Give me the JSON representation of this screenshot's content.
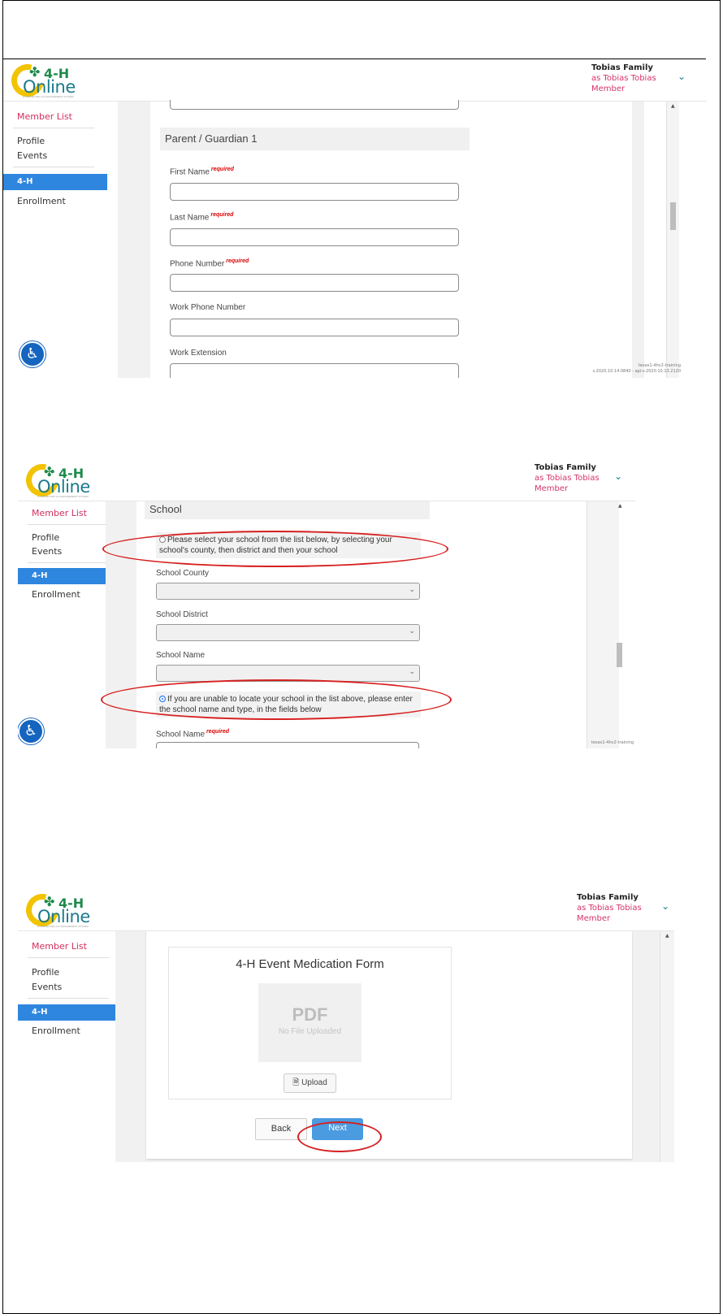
{
  "brand": {
    "logo_4h": "4-H",
    "logo_online": "Online",
    "logo_tagline": "A CONNECTED 4-H MANAGEMENT SYSTEM"
  },
  "header": {
    "family_name": "Tobias Family",
    "acting_as": "as Tobias Tobias",
    "role": "Member"
  },
  "sidebar": {
    "member_list": "Member List",
    "profile": "Profile",
    "events": "Events",
    "section": "4-H",
    "enrollment": "Enrollment"
  },
  "screen1": {
    "section_title": "Parent / Guardian 1",
    "required_tag": "required",
    "fields": {
      "first_name": "First Name",
      "last_name": "Last Name",
      "phone": "Phone Number",
      "work_phone": "Work Phone Number",
      "work_ext": "Work Extension"
    },
    "version_line1": "texas1-4hv2-training",
    "version_line2": "v.2020.10.14.0840 - api:v.2020.10.13.2120"
  },
  "screen2": {
    "section_title": "School",
    "option_list": "Please select your school from the list below, by selecting your school's county, then district and then your school",
    "school_county": "School County",
    "school_district": "School District",
    "school_name": "School Name",
    "option_manual": "If you are unable to locate your school in the list above, please enter the school name and type, in the fields below",
    "school_name_required": "School Name",
    "required_tag": "required",
    "version_line1": "texas1-4hv2-training"
  },
  "screen3": {
    "form_title": "4-H Event Medication Form",
    "pdf_label": "PDF",
    "pdf_status": "No File Uploaded",
    "upload_label": "Upload",
    "back_label": "Back",
    "next_label": "Next"
  },
  "colors": {
    "accent_pink": "#d32f5f",
    "nav_selected": "#2e86de",
    "next_button": "#4a9be0",
    "annotation_red": "#d62020"
  }
}
